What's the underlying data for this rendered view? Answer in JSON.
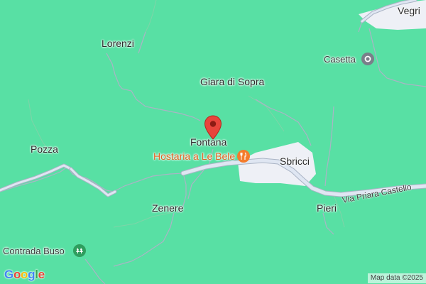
{
  "map": {
    "places": {
      "vegri": "Vegri",
      "lorenzi": "Lorenzi",
      "casetta": "Casetta",
      "giara_di_sopra": "Giara di Sopra",
      "fontana": "Fontana",
      "pozza": "Pozza",
      "sbricci": "Sbricci",
      "zenere": "Zenere",
      "pieri": "Pieri",
      "contrada_buso": "Contrada Buso"
    },
    "poi": {
      "restaurant": "Hostaria a Le Bele",
      "restaurant_icon": "fork-knife-icon",
      "casetta_icon": "place-circle-icon",
      "buso_icon": "park-icon"
    },
    "roads": {
      "via_priara": "Via Priara Castello"
    },
    "pin_icon": "location-pin-icon",
    "colors": {
      "terrain": "#58e0a4",
      "road_fill": "#dfe6f2",
      "road_stroke": "#aab4c5",
      "settlement": "#eef0f6",
      "pin": "#e8453c",
      "restaurant": "#f47c2c",
      "park_icon": "#2f9e5e"
    }
  },
  "logo": {
    "text": "Google"
  },
  "attribution": "Map data ©2025"
}
